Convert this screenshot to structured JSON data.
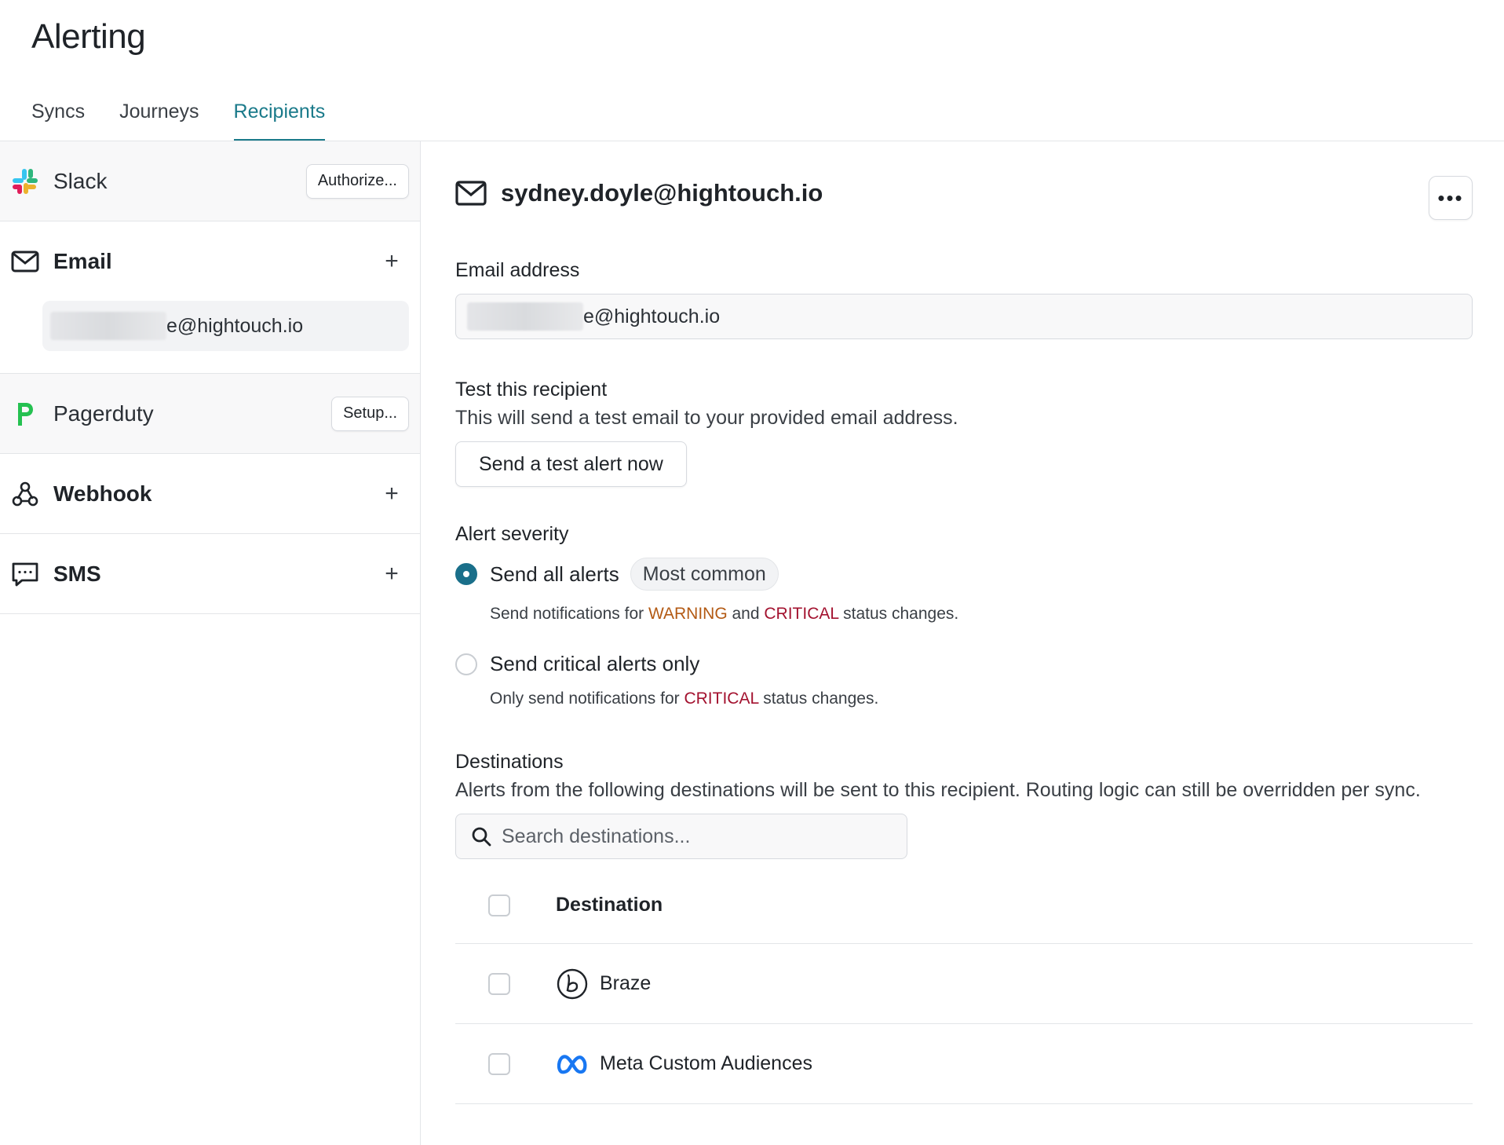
{
  "page": {
    "title": "Alerting"
  },
  "tabs": [
    {
      "label": "Syncs",
      "active": false
    },
    {
      "label": "Journeys",
      "active": false
    },
    {
      "label": "Recipients",
      "active": true
    }
  ],
  "sidebar": {
    "slack": {
      "label": "Slack",
      "action": "Authorize..."
    },
    "email": {
      "label": "Email",
      "entry_suffix": "e@hightouch.io"
    },
    "pagerduty": {
      "label": "Pagerduty",
      "action": "Setup..."
    },
    "webhook": {
      "label": "Webhook"
    },
    "sms": {
      "label": "SMS"
    },
    "add_glyph": "+"
  },
  "recipient": {
    "title": "sydney.doyle@hightouch.io",
    "more_glyph": "•••",
    "email_label": "Email address",
    "email_value_suffix": "e@hightouch.io",
    "test_label": "Test this recipient",
    "test_desc": "This will send a test email to your provided email address.",
    "test_button": "Send a test alert now",
    "severity_label": "Alert severity",
    "severity_options": [
      {
        "label": "Send all alerts",
        "badge": "Most common",
        "checked": true,
        "desc_prefix": "Send notifications for ",
        "desc_warn": "WARNING",
        "desc_mid": " and ",
        "desc_crit": "CRITICAL",
        "desc_suffix": " status changes."
      },
      {
        "label": "Send critical alerts only",
        "checked": false,
        "desc_prefix": "Only send notifications for ",
        "desc_crit": "CRITICAL",
        "desc_suffix": " status changes."
      }
    ],
    "destinations_label": "Destinations",
    "destinations_desc": "Alerts from the following destinations will be sent to this recipient. Routing logic can still be overridden per sync.",
    "search_placeholder": "Search destinations...",
    "table_header": "Destination",
    "destinations": [
      {
        "name": "Braze",
        "icon": "braze-icon"
      },
      {
        "name": "Meta Custom Audiences",
        "icon": "meta-icon"
      }
    ]
  },
  "colors": {
    "accent": "#1a7a8a",
    "radio_checked": "#1a6f8a",
    "warning": "#b35a14",
    "critical": "#a3122f"
  }
}
